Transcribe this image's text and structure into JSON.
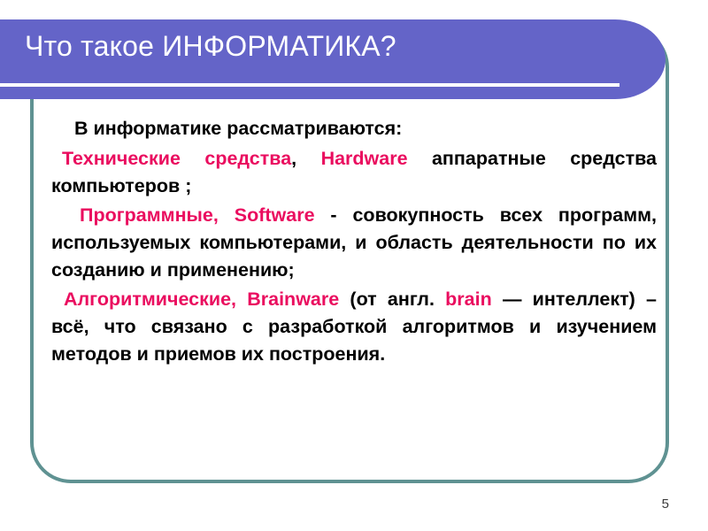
{
  "slide": {
    "title": "Что такое ИНФОРМАТИКА?",
    "page_number": "5",
    "colors": {
      "banner": "#6464c8",
      "frame": "#5f9292",
      "accent_pink": "#ea0d5f",
      "title_text": "#ffffff",
      "body_text": "#000000",
      "background": "#ffffff"
    }
  },
  "content": {
    "intro": "В информатике рассматриваются:",
    "hardware": {
      "term_ru": "Технические средства",
      "comma": ",",
      "term_en": "Hardware",
      "rest": " аппаратные средства компьютеров ;"
    },
    "software": {
      "term": "Программные, Software",
      "rest": " - совокупность всех программ, используемых компьютерами, и область деятельности по их созданию и применению;"
    },
    "brainware": {
      "term": "Алгоритмические, Brainware",
      "open": " (от англ. ",
      "term_en": "brain",
      "rest": " — интеллект) – всё, что связано с разработкой алгоритмов и изучением методов и приемов их построения."
    }
  }
}
